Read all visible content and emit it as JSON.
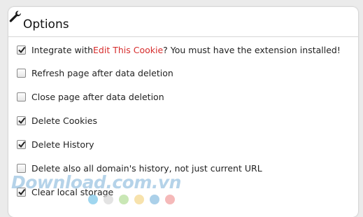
{
  "panel": {
    "title": "Options",
    "title_icon": "wrench-icon"
  },
  "options": [
    {
      "checked": true,
      "parts": {
        "before": "Integrate with ",
        "link": "Edit This Cookie",
        "after": "? You must have the extension installed!"
      }
    },
    {
      "checked": false,
      "label": "Refresh page after data deletion"
    },
    {
      "checked": false,
      "label": "Close page after data deletion"
    },
    {
      "checked": true,
      "label": "Delete Cookies"
    },
    {
      "checked": true,
      "label": "Delete History"
    },
    {
      "checked": false,
      "label": "Delete also all domain's history, not just current URL"
    },
    {
      "checked": true,
      "label": "Clear local storage"
    }
  ],
  "watermark": {
    "text": "Download.com.vn",
    "dot_colors": [
      "#7fc8ea",
      "#d9d9d9",
      "#b7df9c",
      "#f4d890",
      "#8fc0e2",
      "#f2a2a2"
    ]
  },
  "colors": {
    "link": "#d62c2c",
    "background": "#ebebeb"
  }
}
